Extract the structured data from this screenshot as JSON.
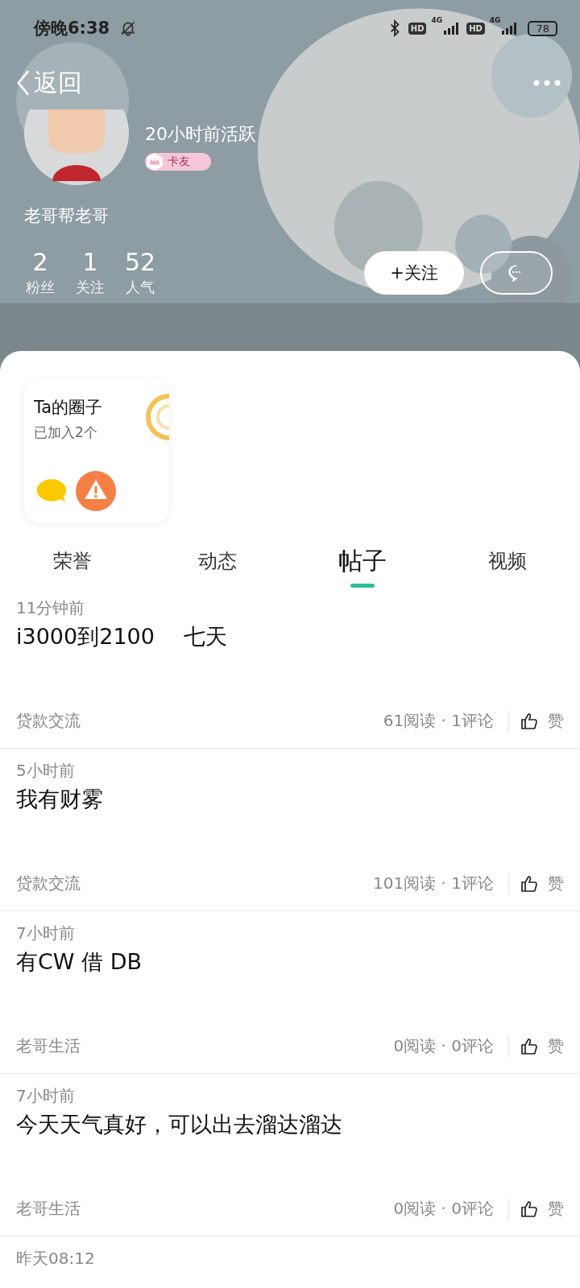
{
  "status_bar": {
    "time": "傍晚6:38",
    "hd_1": "HD",
    "net_1": "4G",
    "hd_2": "HD",
    "net_2": "4G",
    "battery": "78"
  },
  "nav": {
    "back": "返回"
  },
  "profile": {
    "active": "20小时前活跃",
    "badge": "卡友",
    "signature": "老哥帮老哥",
    "stats": [
      {
        "value": "2",
        "label": "粉丝"
      },
      {
        "value": "1",
        "label": "关注"
      },
      {
        "value": "52",
        "label": "人气"
      }
    ],
    "follow_button": "+关注"
  },
  "circles": {
    "title": "Ta的圈子",
    "count": "已加入2个"
  },
  "tabs": [
    {
      "label": "荣誉",
      "selected": false
    },
    {
      "label": "动态",
      "selected": false
    },
    {
      "label": "帖子",
      "selected": true
    },
    {
      "label": "视频",
      "selected": false
    }
  ],
  "posts": [
    {
      "time": "11分钟前",
      "title": "i3000到2100　 七天",
      "category": "贷款交流",
      "stats": "61阅读 · 1评论",
      "like": "赞"
    },
    {
      "time": "5小时前",
      "title": "我有财雾",
      "category": "贷款交流",
      "stats": "101阅读 · 1评论",
      "like": "赞"
    },
    {
      "time": "7小时前",
      "title": "有CW  借 DB",
      "category": "老哥生活",
      "stats": "0阅读 · 0评论",
      "like": "赞"
    },
    {
      "time": "7小时前",
      "title": "今天天气真好，可以出去溜达溜达",
      "category": "老哥生活",
      "stats": "0阅读 · 0评论",
      "like": "赞"
    },
    {
      "time": "昨天08:12"
    }
  ]
}
